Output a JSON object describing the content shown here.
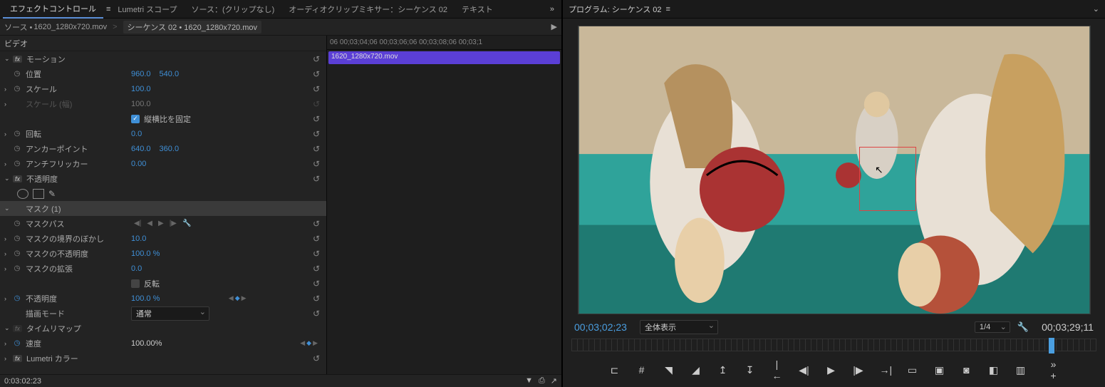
{
  "tabs": {
    "effect_controls": "エフェクトコントロール",
    "lumetri": "Lumetri スコープ",
    "source": "ソース：(クリップなし)",
    "audio_mixer": "オーディオクリップミキサー：シーケンス 02",
    "text": "テキスト"
  },
  "source_row": {
    "source_prefix": "ソース •",
    "clip_name": "1620_1280x720.mov",
    "seq_label": "シーケンス 02 •",
    "seq_clip": "1620_1280x720.mov"
  },
  "sections": {
    "video": "ビデオ",
    "motion": "モーション",
    "opacity": "不透明度",
    "time_remap": "タイムリマップ",
    "lumetri": "Lumetri カラー"
  },
  "props": {
    "position": "位置",
    "pos_x": "960.0",
    "pos_y": "540.0",
    "scale": "スケール",
    "scale_v": "100.0",
    "scale_w": "スケール (幅)",
    "scale_w_v": "100.0",
    "uniform": "縦横比を固定",
    "rotation": "回転",
    "rotation_v": "0.0",
    "anchor": "アンカーポイント",
    "anchor_x": "640.0",
    "anchor_y": "360.0",
    "antiflicker": "アンチフリッカー",
    "antiflicker_v": "0.00",
    "mask1": "マスク (1)",
    "mask_path": "マスクパス",
    "mask_feather": "マスクの境界のぼかし",
    "mask_feather_v": "10.0",
    "mask_opacity": "マスクの不透明度",
    "mask_opacity_v": "100.0 %",
    "mask_expansion": "マスクの拡張",
    "mask_expansion_v": "0.0",
    "invert": "反転",
    "opacity_label": "不透明度",
    "opacity_v": "100.0 %",
    "blend": "描画モード",
    "blend_v": "通常",
    "speed": "速度",
    "speed_v": "100.00%"
  },
  "timeline": {
    "ruler": "06 00;03;04;06 00;03;06;06 00;03;08;06 00;03;1",
    "clip": "1620_1280x720.mov"
  },
  "bottom_tc": "0:03:02:23",
  "program": {
    "title": "プログラム: シーケンス 02",
    "tc_left": "00;03;02;23",
    "fit": "全体表示",
    "res": "1/4",
    "tc_right": "00;03;29;11"
  }
}
